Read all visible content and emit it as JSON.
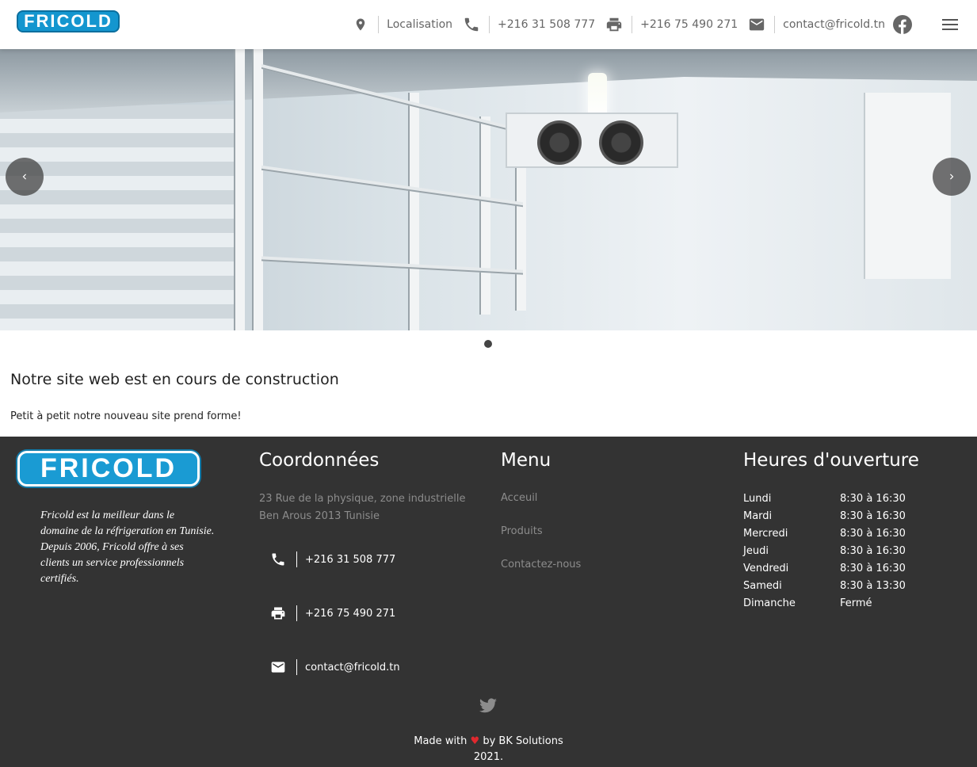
{
  "header": {
    "logo_text": "FRICOLD",
    "location_label": "Localisation",
    "phone": "+216 31 508 777",
    "fax": "+216 75 490 271",
    "email": "contact@fricold.tn"
  },
  "carousel": {
    "slide_count": 1,
    "active_slide": 1
  },
  "main": {
    "title": "Notre site web est en cours de construction",
    "subtitle": "Petit à petit notre nouveau site prend forme!"
  },
  "footer": {
    "logo_text": "FRICOLD",
    "description": "Fricold est la meilleur dans le domaine de la réfrigeration en Tunisie. Depuis 2006, Fricold offre à ses clients un service professionnels certifiés.",
    "coords_heading": "Coordonnées",
    "address_line1": "23 Rue de la physique, zone industrielle",
    "address_line2": "Ben Arous 2013 Tunisie",
    "phone": "+216 31 508 777",
    "fax": "+216 75 490 271",
    "email": "contact@fricold.tn",
    "menu_heading": "Menu",
    "menu_items": [
      "Acceuil",
      "Produits",
      "Contactez-nous"
    ],
    "hours_heading": "Heures d'ouverture",
    "hours": [
      {
        "day": "Lundi",
        "time": "8:30 à 16:30"
      },
      {
        "day": "Mardi",
        "time": "8:30 à 16:30"
      },
      {
        "day": "Mercredi",
        "time": "8:30 à 16:30"
      },
      {
        "day": "Jeudi",
        "time": "8:30 à 16:30"
      },
      {
        "day": "Vendredi",
        "time": "8:30 à 16:30"
      },
      {
        "day": "Samedi",
        "time": "8:30 à 13:30"
      },
      {
        "day": "Dimanche",
        "time": "Fermé"
      }
    ],
    "made_with_prefix": "Made with",
    "made_with_heart": "♥",
    "made_with_by": "by  BK Solutions",
    "year": "2021."
  },
  "colors": {
    "brand_blue": "#1a9bd3",
    "footer_bg": "#333333",
    "muted_text": "#8c8c8c",
    "heart": "#e0282e"
  },
  "icons": [
    "location-icon",
    "phone-icon",
    "print-icon",
    "mail-icon",
    "facebook-icon",
    "menu-icon",
    "chevron-left-icon",
    "chevron-right-icon",
    "twitter-icon"
  ]
}
